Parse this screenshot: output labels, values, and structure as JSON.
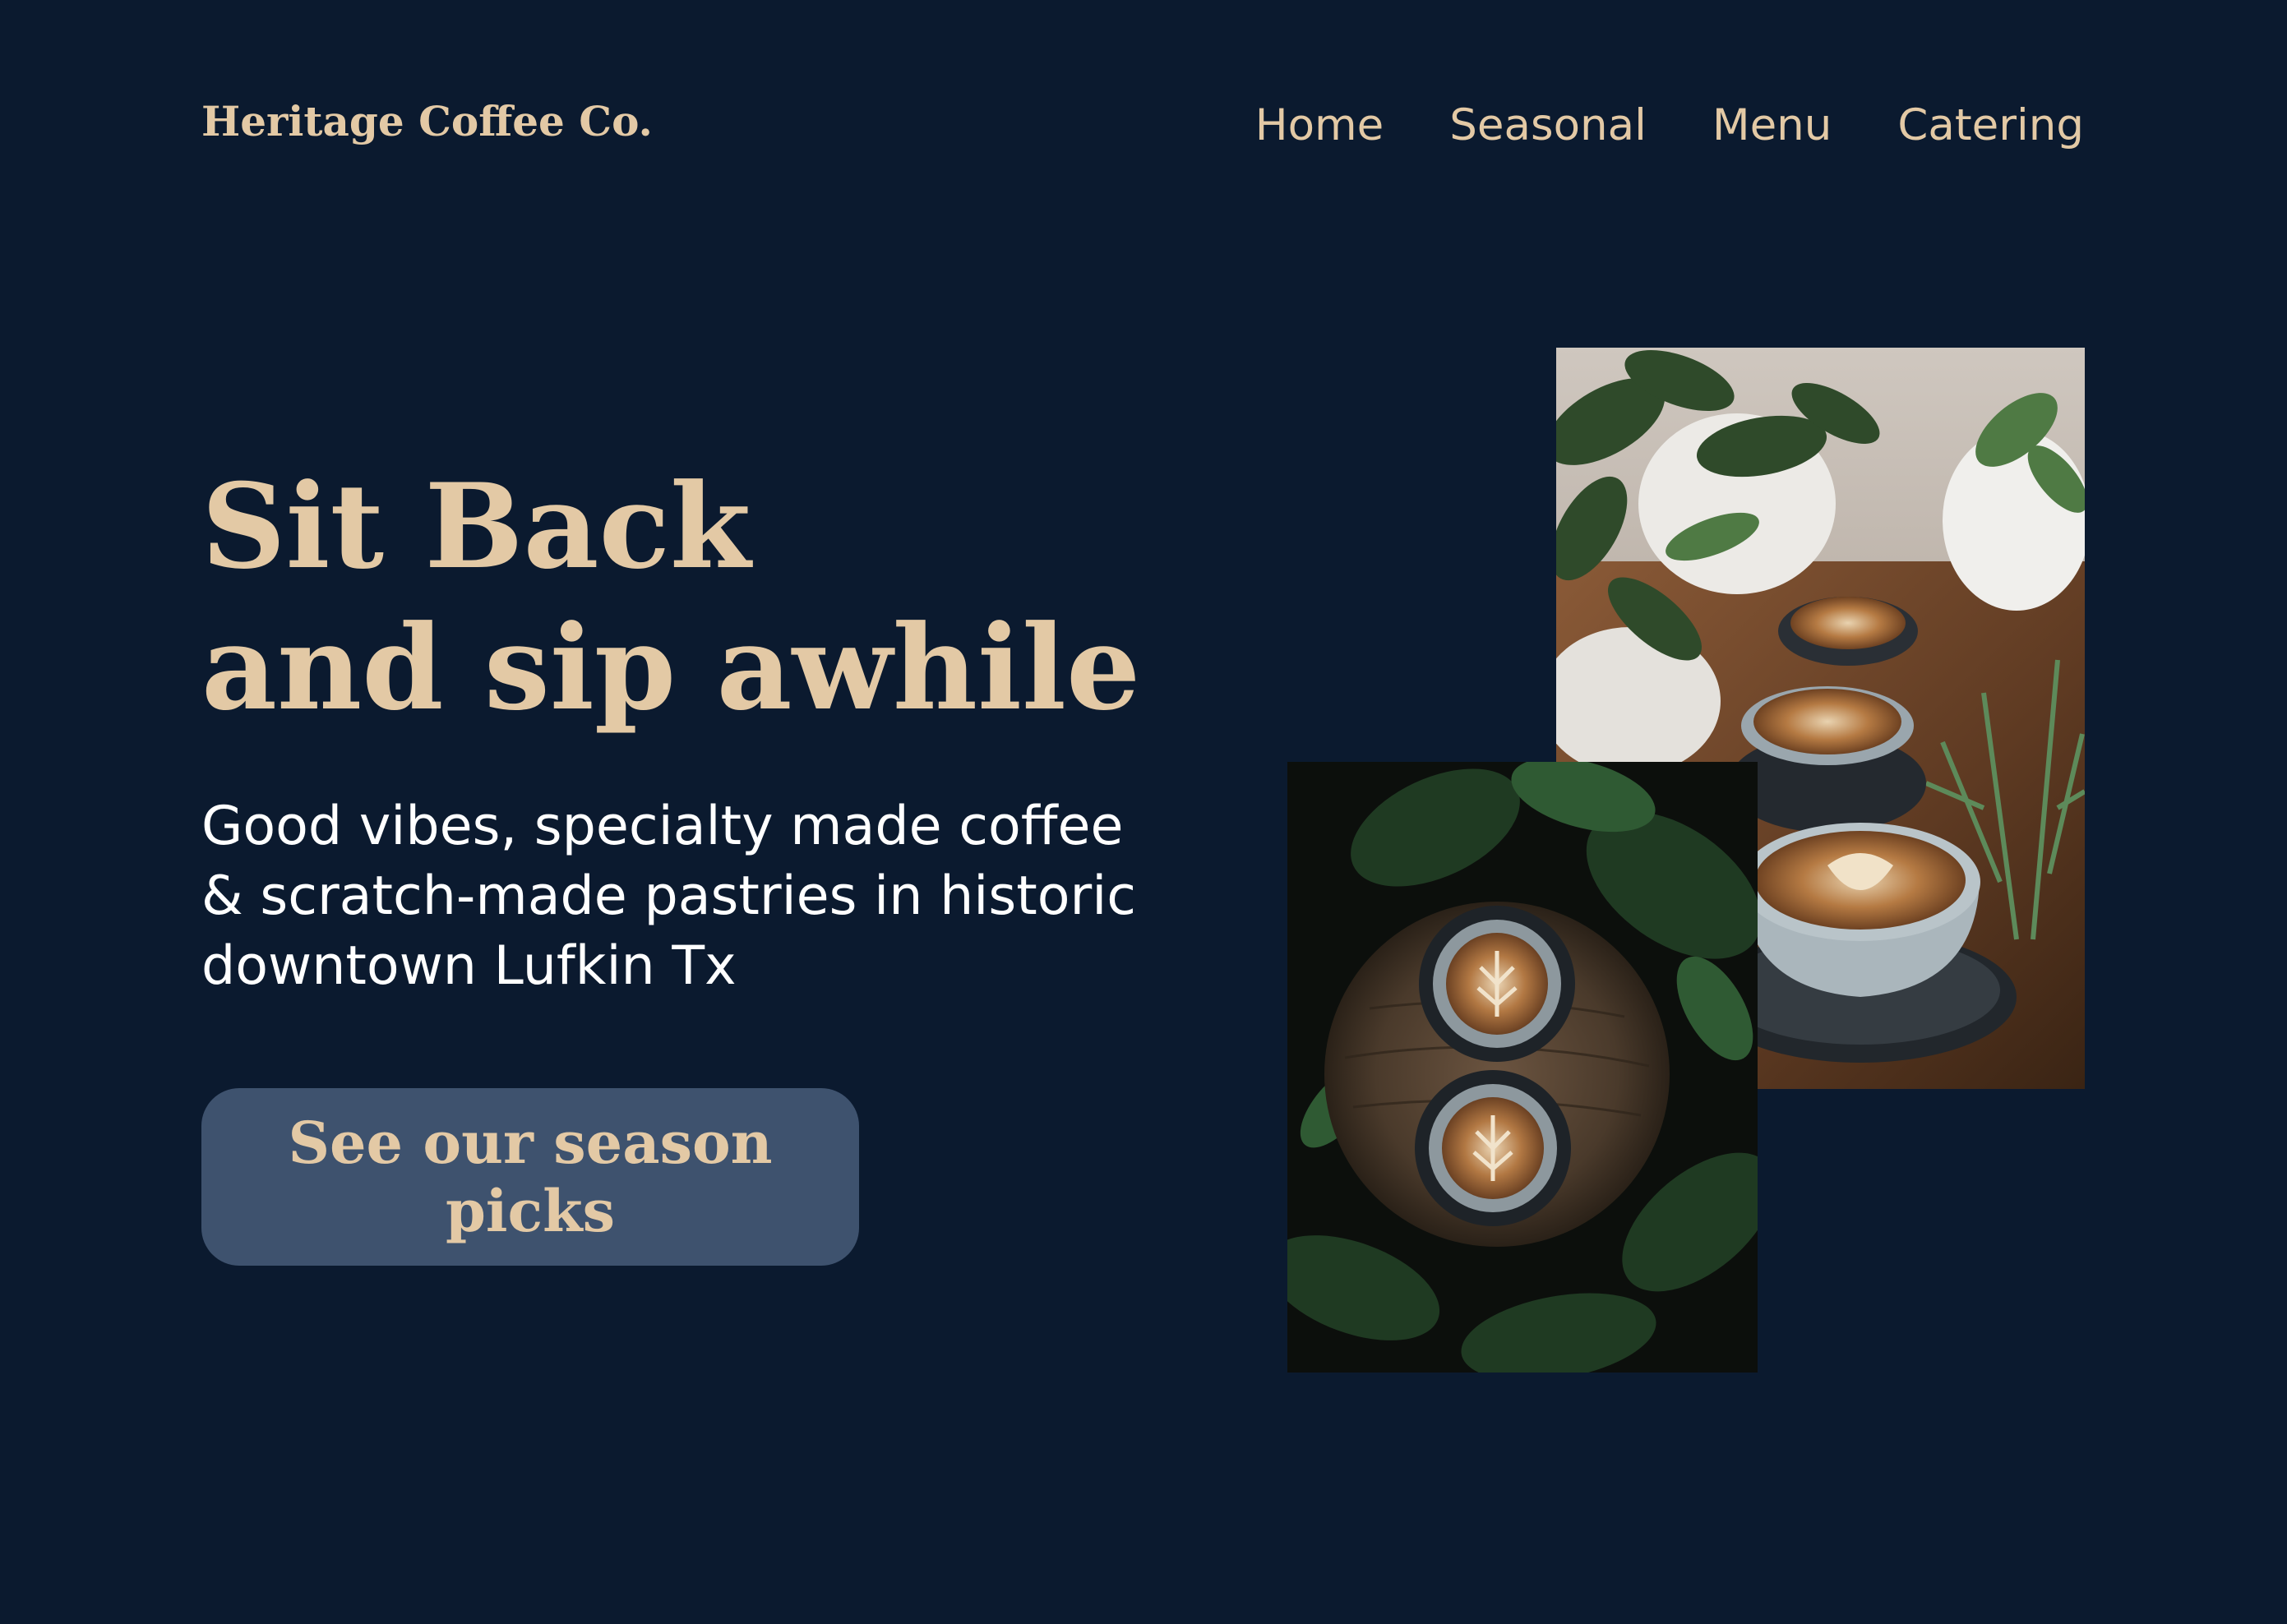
{
  "brand": {
    "name": "Heritage Coffee Co."
  },
  "nav": {
    "items": [
      {
        "label": "Home"
      },
      {
        "label": "Seasonal"
      },
      {
        "label": "Menu"
      },
      {
        "label": "Catering"
      }
    ]
  },
  "hero": {
    "title_lines": [
      "Sit Back",
      "and sip awhile"
    ],
    "subtitle_lines": [
      "Good vibes, specialty made coffee",
      "& scratch-made pastries in historic",
      "downtown Lufkin Tx"
    ],
    "cta_label": "See our season picks"
  },
  "images": [
    {
      "name": "lattes-with-plants-photo",
      "icon": "photo"
    },
    {
      "name": "lattes-on-wooden-stool-photo",
      "icon": "photo"
    }
  ],
  "colors": {
    "background": "#0b1a2f",
    "accent": "#e3c9a5",
    "button": "#3e526e",
    "body_text": "#ffffff"
  }
}
